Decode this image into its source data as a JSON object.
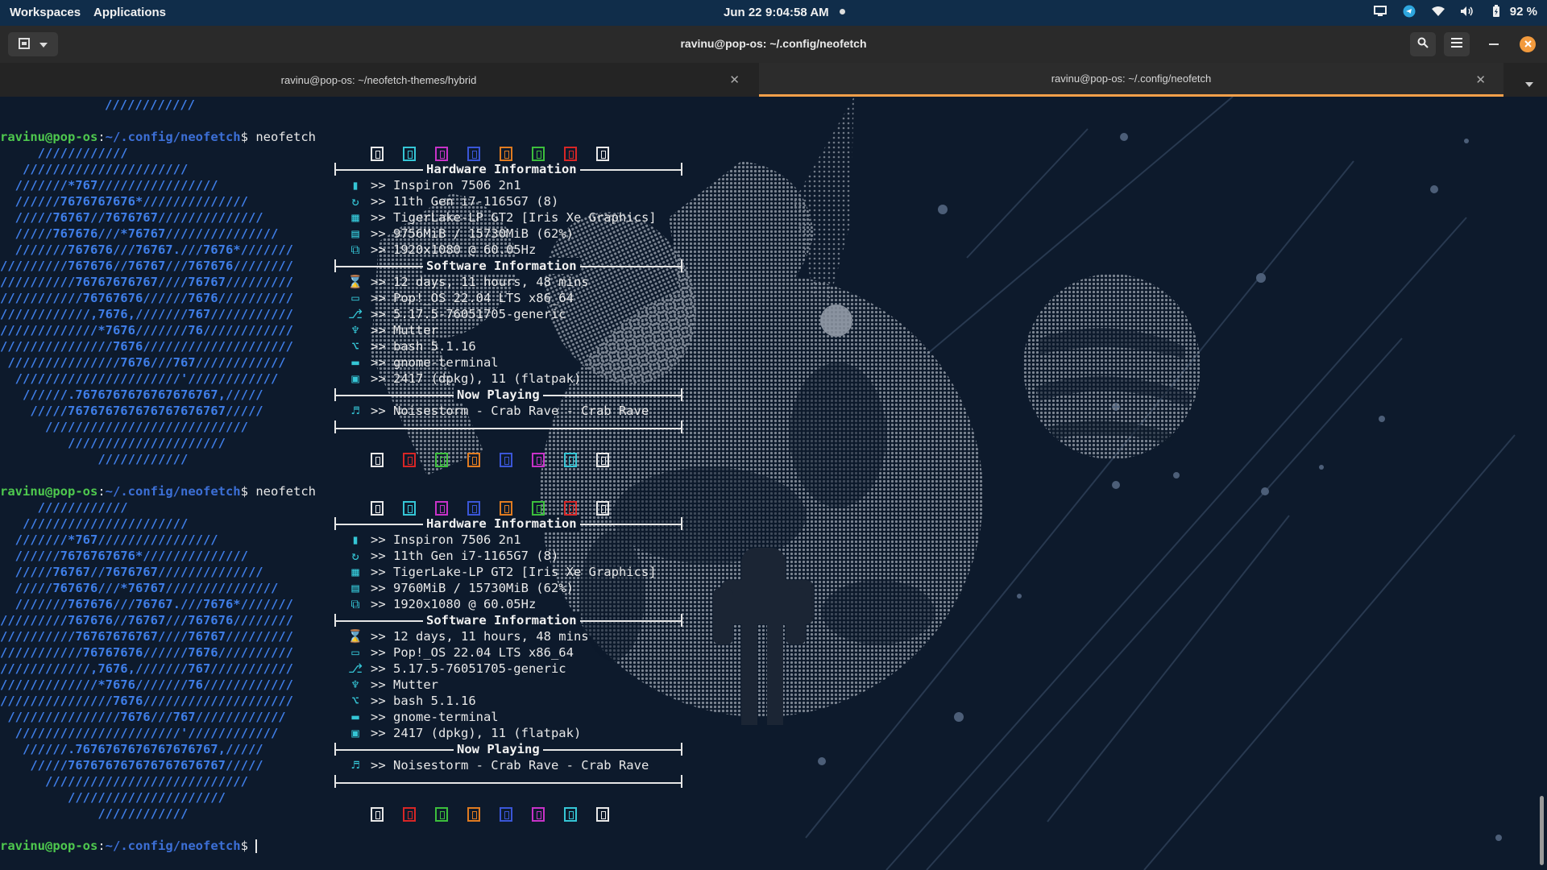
{
  "topbar": {
    "workspaces": "Workspaces",
    "applications": "Applications",
    "date": "Jun 22",
    "time": "9:04:58 AM",
    "battery": "92 %"
  },
  "window": {
    "title": "ravinu@pop-os: ~/.config/neofetch"
  },
  "tabs": [
    {
      "label": "ravinu@pop-os: ~/neofetch-themes/hybrid",
      "active": false
    },
    {
      "label": "ravinu@pop-os: ~/.config/neofetch",
      "active": true
    }
  ],
  "terminal": {
    "prompt_user": "ravinu@pop-os",
    "prompt_sep": ":",
    "prompt_path": "~/.config/neofetch",
    "prompt_dollar": "$ ",
    "command": "neofetch",
    "top_fragment": "////////////",
    "logo": [
      "     ////////////",
      "   //////////////////////",
      "  ///////*767////////////////",
      "  //////7676767676*//////////////",
      "  /////76767//7676767//////////////",
      "  /////767676///*76767///////////////",
      "  ///////767676///76767.///7676*///////",
      "/////////767676//76767///767676////////",
      "//////////76767676767////76767/////////",
      "///////////76767676//////7676//////////",
      "////////////,7676,///////767///////////",
      "/////////////*7676///////76////////////",
      "///////////////7676////////////////////",
      " ///////////////7676///767////////////",
      "  //////////////////////'////////////",
      "   //////.7676767676767676767,/////",
      "    /////767676767676767676767/////",
      "      ///////////////////////////",
      "         /////////////////////",
      "             ////////////"
    ],
    "runs": [
      {
        "hardware_title": "Hardware Information",
        "hardware": [
          {
            "icon": "laptop-icon",
            "glyph": "▮",
            "text": ">> Inspiron 7506 2n1"
          },
          {
            "icon": "cpu-icon",
            "glyph": "↻",
            "text": ">> 11th Gen i7-1165G7 (8)"
          },
          {
            "icon": "gpu-icon",
            "glyph": "▦",
            "text": ">> TigerLake-LP GT2 [Iris Xe Graphics]"
          },
          {
            "icon": "memory-icon",
            "glyph": "▤",
            "text": ">> 9756MiB / 15730MiB (62%)"
          },
          {
            "icon": "display-icon",
            "glyph": "⧉",
            "text": ">> 1920x1080 @ 60.05Hz"
          }
        ],
        "software_title": "Software Information",
        "software": [
          {
            "icon": "uptime-icon",
            "glyph": "⌛",
            "text": ">> 12 days, 11 hours, 48 mins"
          },
          {
            "icon": "os-icon",
            "glyph": "▭",
            "text": ">> Pop!_OS 22.04 LTS x86_64"
          },
          {
            "icon": "kernel-icon",
            "glyph": "⎇",
            "text": ">> 5.17.5-76051705-generic"
          },
          {
            "icon": "wm-icon",
            "glyph": "♆",
            "text": ">> Mutter"
          },
          {
            "icon": "shell-icon",
            "glyph": "⌥",
            "text": ">> bash 5.1.16"
          },
          {
            "icon": "terminal-icon",
            "glyph": "▬",
            "text": ">> gnome-terminal"
          },
          {
            "icon": "packages-icon",
            "glyph": "▣",
            "text": ">> 2417 (dpkg), 11 (flatpak)"
          }
        ],
        "music_title": "Now Playing",
        "music": [
          {
            "icon": "music-icon",
            "glyph": "♬",
            "text": ">> Noisestorm - Crab Rave - Crab Rave"
          }
        ],
        "colors_top": [
          "#e8e8e8",
          "#35c6d6",
          "#c832c8",
          "#3a56d8",
          "#e07b20",
          "#3cbf3c",
          "#d82626",
          "#e8e8e8"
        ],
        "colors_bottom": [
          "#e8e8e8",
          "#d82626",
          "#3cbf3c",
          "#e07b20",
          "#3a56d8",
          "#c832c8",
          "#35c6d6",
          "#e8e8e8"
        ]
      },
      {
        "hardware_title": "Hardware Information",
        "hardware": [
          {
            "icon": "laptop-icon",
            "glyph": "▮",
            "text": ">> Inspiron 7506 2n1"
          },
          {
            "icon": "cpu-icon",
            "glyph": "↻",
            "text": ">> 11th Gen i7-1165G7 (8)"
          },
          {
            "icon": "gpu-icon",
            "glyph": "▦",
            "text": ">> TigerLake-LP GT2 [Iris Xe Graphics]"
          },
          {
            "icon": "memory-icon",
            "glyph": "▤",
            "text": ">> 9760MiB / 15730MiB (62%)"
          },
          {
            "icon": "display-icon",
            "glyph": "⧉",
            "text": ">> 1920x1080 @ 60.05Hz"
          }
        ],
        "software_title": "Software Information",
        "software": [
          {
            "icon": "uptime-icon",
            "glyph": "⌛",
            "text": ">> 12 days, 11 hours, 48 mins"
          },
          {
            "icon": "os-icon",
            "glyph": "▭",
            "text": ">> Pop!_OS 22.04 LTS x86_64"
          },
          {
            "icon": "kernel-icon",
            "glyph": "⎇",
            "text": ">> 5.17.5-76051705-generic"
          },
          {
            "icon": "wm-icon",
            "glyph": "♆",
            "text": ">> Mutter"
          },
          {
            "icon": "shell-icon",
            "glyph": "⌥",
            "text": ">> bash 5.1.16"
          },
          {
            "icon": "terminal-icon",
            "glyph": "▬",
            "text": ">> gnome-terminal"
          },
          {
            "icon": "packages-icon",
            "glyph": "▣",
            "text": ">> 2417 (dpkg), 11 (flatpak)"
          }
        ],
        "music_title": "Now Playing",
        "music": [
          {
            "icon": "music-icon",
            "glyph": "♬",
            "text": ">> Noisestorm - Crab Rave - Crab Rave"
          }
        ],
        "colors_top": [
          "#e8e8e8",
          "#35c6d6",
          "#c832c8",
          "#3a56d8",
          "#e07b20",
          "#3cbf3c",
          "#d82626",
          "#e8e8e8"
        ],
        "colors_bottom": [
          "#e8e8e8",
          "#d82626",
          "#3cbf3c",
          "#e07b20",
          "#3a56d8",
          "#c832c8",
          "#35c6d6",
          "#e8e8e8"
        ]
      }
    ]
  },
  "colors": {
    "accent": "#f6a04a",
    "close_button": "#f29a3d",
    "panel": "#102d4a",
    "prompt_user": "#4ec84e",
    "prompt_path": "#3c6fd6",
    "logo": "#3f7ee8"
  }
}
